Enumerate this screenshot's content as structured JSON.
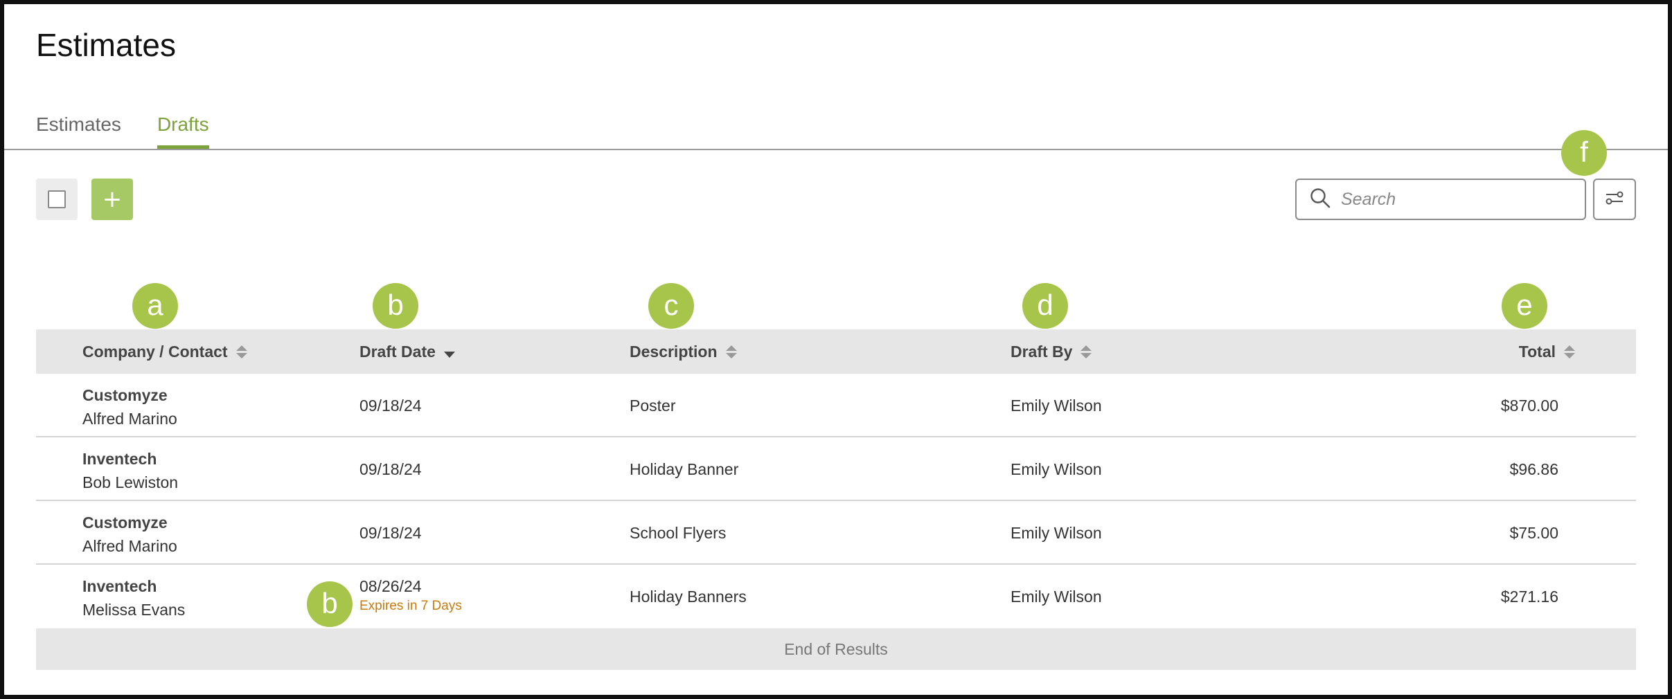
{
  "page": {
    "title": "Estimates"
  },
  "tabs": [
    {
      "label": "Estimates",
      "active": false
    },
    {
      "label": "Drafts",
      "active": true
    }
  ],
  "toolbar": {
    "add_label": "+",
    "search_placeholder": "Search"
  },
  "callouts": {
    "a": "a",
    "b": "b",
    "c": "c",
    "d": "d",
    "e": "e",
    "f": "f"
  },
  "table": {
    "columns": {
      "company": "Company / Contact",
      "draft_date": "Draft Date",
      "description": "Description",
      "draft_by": "Draft By",
      "total": "Total"
    },
    "rows": [
      {
        "company": "Customyze",
        "contact": "Alfred Marino",
        "date": "09/18/24",
        "expires": "",
        "description": "Poster",
        "draft_by": "Emily Wilson",
        "total": "$870.00"
      },
      {
        "company": "Inventech",
        "contact": "Bob Lewiston",
        "date": "09/18/24",
        "expires": "",
        "description": "Holiday Banner",
        "draft_by": "Emily Wilson",
        "total": "$96.86"
      },
      {
        "company": "Customyze",
        "contact": "Alfred Marino",
        "date": "09/18/24",
        "expires": "",
        "description": "School Flyers",
        "draft_by": "Emily Wilson",
        "total": "$75.00"
      },
      {
        "company": "Inventech",
        "contact": "Melissa Evans",
        "date": "08/26/24",
        "expires": "Expires in 7 Days",
        "description": "Holiday Banners",
        "draft_by": "Emily Wilson",
        "total": "$271.16"
      }
    ],
    "end_label": "End of Results"
  },
  "colors": {
    "accent": "#7ca23a",
    "callout": "#a6c54a",
    "add_button": "#a6c965",
    "expires": "#c97a0a",
    "header_bg": "#e6e6e6"
  },
  "icons": {
    "search": "search-icon",
    "filter": "filter-sliders-icon",
    "sort": "sort-icon"
  }
}
